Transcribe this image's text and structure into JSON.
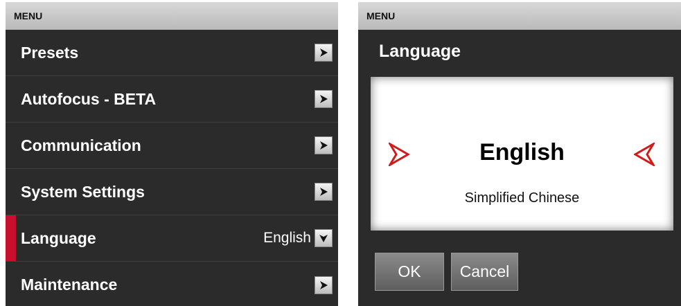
{
  "left": {
    "title": "MENU",
    "items": [
      {
        "label": "Presets",
        "icon": "chevron-right-icon"
      },
      {
        "label": "Autofocus - BETA",
        "icon": "chevron-right-icon"
      },
      {
        "label": "Communication",
        "icon": "chevron-right-icon"
      },
      {
        "label": "System Settings",
        "icon": "chevron-right-icon"
      },
      {
        "label": "Language",
        "value": "English",
        "icon": "chevron-down-icon",
        "active": true
      },
      {
        "label": "Maintenance",
        "icon": "chevron-right-icon"
      }
    ]
  },
  "right": {
    "title": "MENU",
    "heading": "Language",
    "picker": {
      "selected": "English",
      "other": "Simplified Chinese",
      "left_icon": "arrow-right-icon",
      "right_icon": "arrow-left-icon"
    },
    "ok_label": "OK",
    "cancel_label": "Cancel"
  },
  "colors": {
    "accent": "#c8102e",
    "panel_bg": "#2b2b2b",
    "titlebar": "#c8c8c8"
  }
}
